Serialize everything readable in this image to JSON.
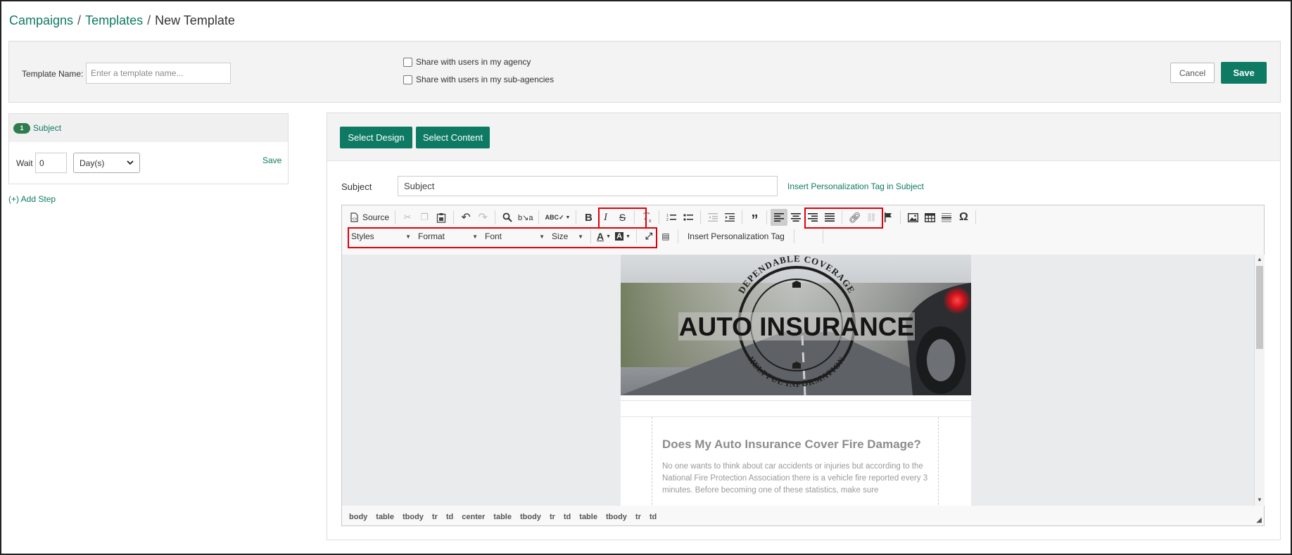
{
  "breadcrumb": {
    "items": [
      "Campaigns",
      "Templates"
    ],
    "separator": "/",
    "current": "New Template"
  },
  "template_bar": {
    "name_label": "Template Name:",
    "name_placeholder": "Enter a template name...",
    "name_value": "",
    "share_agency": {
      "label": "Share with users in my agency",
      "checked": false
    },
    "share_subagencies": {
      "label": "Share with users in my sub-agencies",
      "checked": false
    },
    "cancel_label": "Cancel",
    "save_label": "Save"
  },
  "steps": {
    "items": [
      {
        "number": "1",
        "title": "Subject",
        "wait_label": "Wait",
        "wait_value": "0",
        "unit": "Day(s)",
        "save_label": "Save"
      }
    ],
    "add_step_label": "(+) Add Step"
  },
  "main": {
    "select_design_label": "Select Design",
    "select_content_label": "Select Content",
    "subject_label": "Subject",
    "subject_value": "Subject",
    "insert_tag_label": "Insert Personalization Tag in Subject"
  },
  "editor": {
    "source_label": "Source",
    "combos": {
      "styles": "Styles",
      "format": "Format",
      "font": "Font",
      "size": "Size"
    },
    "insert_tag_label": "Insert Personalization Tag",
    "path": [
      "body",
      "table",
      "tbody",
      "tr",
      "td",
      "center",
      "table",
      "tbody",
      "tr",
      "td",
      "table",
      "tbody",
      "tr",
      "td"
    ],
    "active_alignment": "left",
    "highlight_color": "#e0000a"
  },
  "email": {
    "hero": {
      "top_arc_text": "DEPENDABLE COVERAGE",
      "bottom_arc_text": "HELPFUL INFORMATION",
      "title": "AUTO INSURANCE"
    },
    "article_title": "Does My Auto Insurance Cover Fire Damage?",
    "article_body": "No one wants to think about car accidents or injuries but according to the National Fire Protection Association there is a vehicle fire reported every 3 minutes. Before becoming one of these statistics, make sure"
  },
  "colors": {
    "brand_green": "#0e7a63",
    "badge_green": "#2f7d4f"
  }
}
